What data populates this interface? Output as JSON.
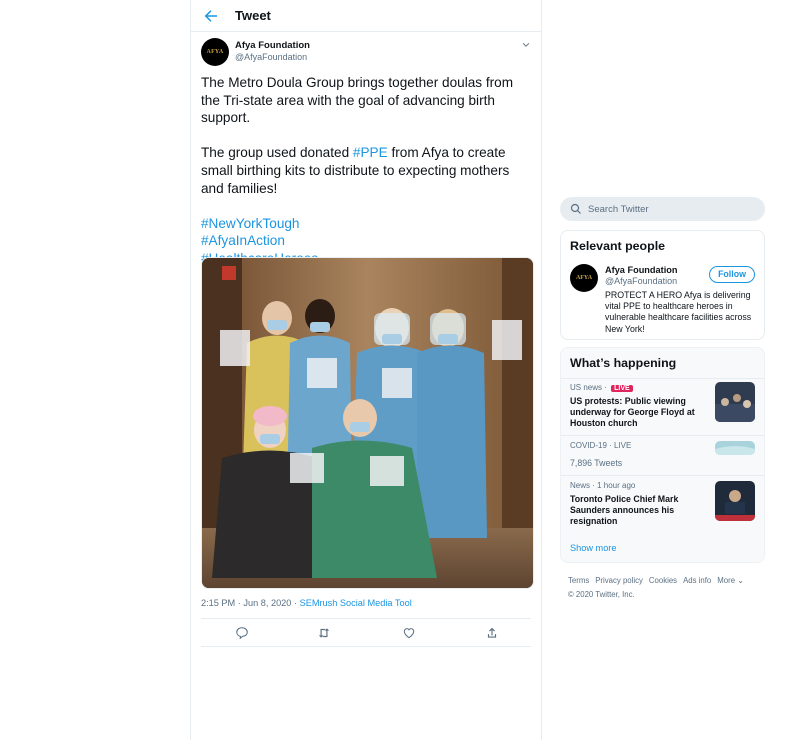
{
  "header": {
    "title": "Tweet"
  },
  "tweet": {
    "author_name": "Afya Foundation",
    "author_handle": "@AfyaFoundation",
    "avatar_text": "AFYA",
    "para1": "The Metro Doula Group brings together doulas from the Tri-state area with the goal of advancing birth support.",
    "para2_before": "The group used donated ",
    "para2_tag": "#PPE",
    "para2_after": " from Afya to create small birthing kits to distribute to expecting mothers and families!",
    "hashtags": [
      "#NewYorkTough",
      "#AfyaInAction",
      "#HealthcareHeroes"
    ],
    "time": "2:15 PM · Jun 8, 2020",
    "meta_sep": " · ",
    "source": "SEMrush Social Media Tool"
  },
  "search": {
    "placeholder": "Search Twitter"
  },
  "relevant_people": {
    "title": "Relevant people",
    "name": "Afya Foundation",
    "handle": "@AfyaFoundation",
    "follow_label": "Follow",
    "bio": "PROTECT A HERO Afya is delivering vital PPE to healthcare heroes in vulnerable healthcare facilities across New York!"
  },
  "whats_happening": {
    "title": "What’s happening",
    "trends": [
      {
        "category": "US news · ",
        "live": "LIVE",
        "title": "US protests: Public viewing underway for George Floyd at Houston church"
      },
      {
        "category": "COVID-19 · LIVE",
        "count": "7,896 Tweets"
      },
      {
        "category": "News · 1 hour ago",
        "title": "Toronto Police Chief Mark Saunders announces his resignation"
      }
    ],
    "show_more": "Show more"
  },
  "footer": {
    "links": [
      "Terms",
      "Privacy policy",
      "Cookies",
      "Ads info",
      "More"
    ],
    "copyright": "© 2020 Twitter, Inc."
  },
  "colors": {
    "accent": "#1b95e0",
    "live": "#e0245e",
    "secondary_text": "#5b7083"
  }
}
